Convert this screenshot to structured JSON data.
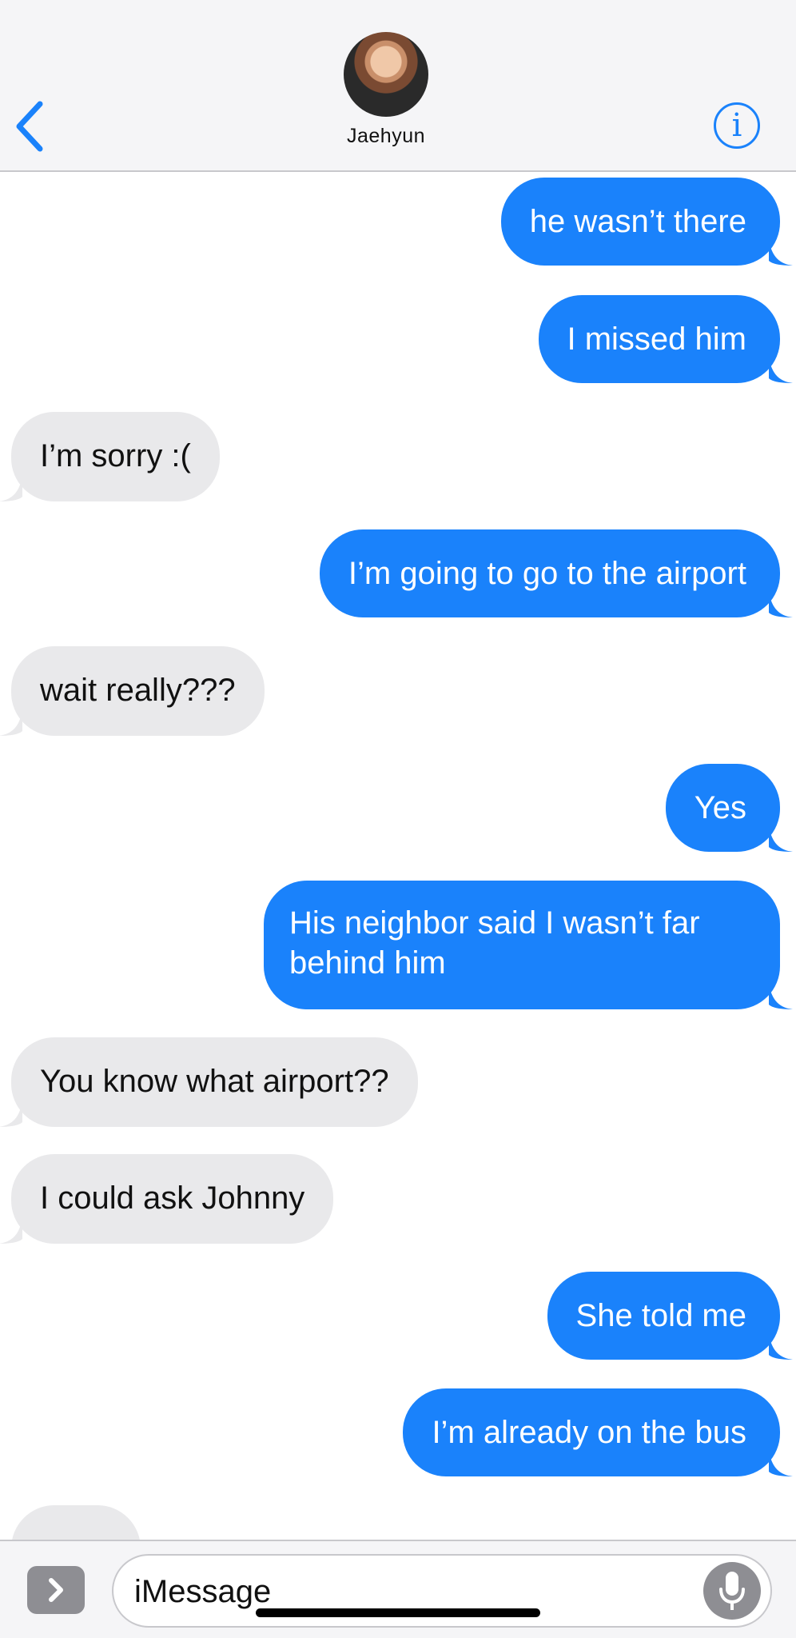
{
  "header": {
    "contact_name": "Jaehyun"
  },
  "messages": [
    {
      "from": "me",
      "text": "he wasn’t there"
    },
    {
      "from": "me",
      "text": "I missed him"
    },
    {
      "from": "them",
      "text": "I’m sorry :("
    },
    {
      "from": "me",
      "text": "I’m going to go to the airport"
    },
    {
      "from": "them",
      "text": "wait really???"
    },
    {
      "from": "me",
      "text": "Yes"
    },
    {
      "from": "me",
      "text": "His neighbor said I wasn’t far behind him"
    },
    {
      "from": "them",
      "text": "You know what airport??"
    },
    {
      "from": "them",
      "text": "I could ask Johnny"
    },
    {
      "from": "me",
      "text": "She told me"
    },
    {
      "from": "me",
      "text": "I’m already on the bus"
    }
  ],
  "input": {
    "placeholder": "iMessage"
  },
  "colors": {
    "sent_bubble": "#1a82fb",
    "received_bubble": "#e9e9eb",
    "accent": "#1a82fb"
  },
  "icons": {
    "back": "chevron-left-icon",
    "info": "info-icon",
    "apps": "chevron-right-icon",
    "mic": "microphone-icon"
  }
}
